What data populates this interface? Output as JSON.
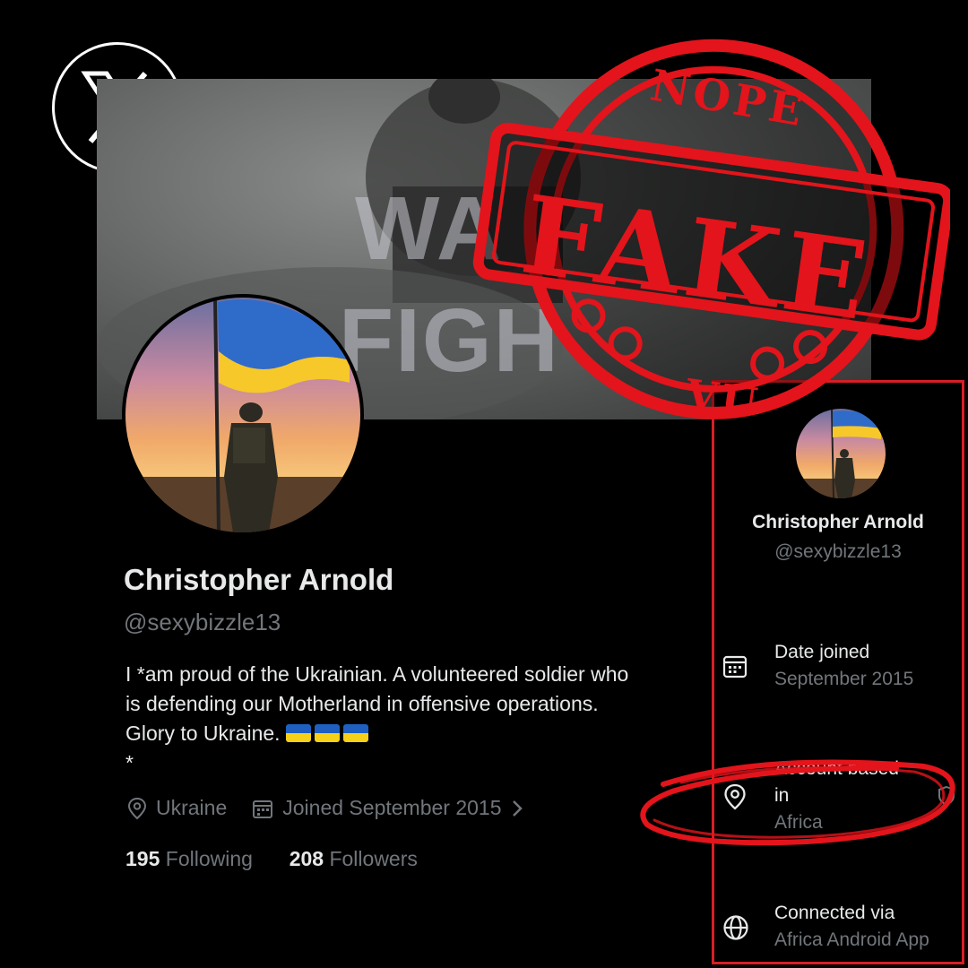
{
  "banner": {
    "line1": "WA",
    "line2": "FIGH"
  },
  "profile": {
    "name": "Christopher Arnold",
    "handle": "@sexybizzle13",
    "bio_line1": "I *am proud of the Ukrainian. A volunteered soldier who",
    "bio_line2": "is defending our Motherland in offensive operations.",
    "bio_line3": "Glory to Ukraine.",
    "bio_line4": "*",
    "location": "Ukraine",
    "joined": "Joined September 2015",
    "following_count": "195",
    "following_label": "Following",
    "followers_count": "208",
    "followers_label": "Followers"
  },
  "about_panel": {
    "name": "Christopher Arnold",
    "handle": "@sexybizzle13",
    "date_joined_label": "Date joined",
    "date_joined_value": "September 2015",
    "account_based_label": "Account based",
    "account_based_label2": "in",
    "account_based_value": "Africa",
    "connected_label": "Connected via",
    "connected_value": "Africa Android App"
  },
  "stamp": {
    "top": "NOPE",
    "main": "FAKE",
    "bottom": "VU"
  },
  "colors": {
    "stamp_red": "#e3141b",
    "panel_border": "#d62024",
    "flag_blue": "#1f5fbf",
    "flag_yellow": "#f7d117"
  },
  "icons": [
    "x-logo-icon",
    "location-pin-icon",
    "calendar-icon",
    "chevron-right-icon",
    "globe-icon",
    "shield-icon"
  ]
}
